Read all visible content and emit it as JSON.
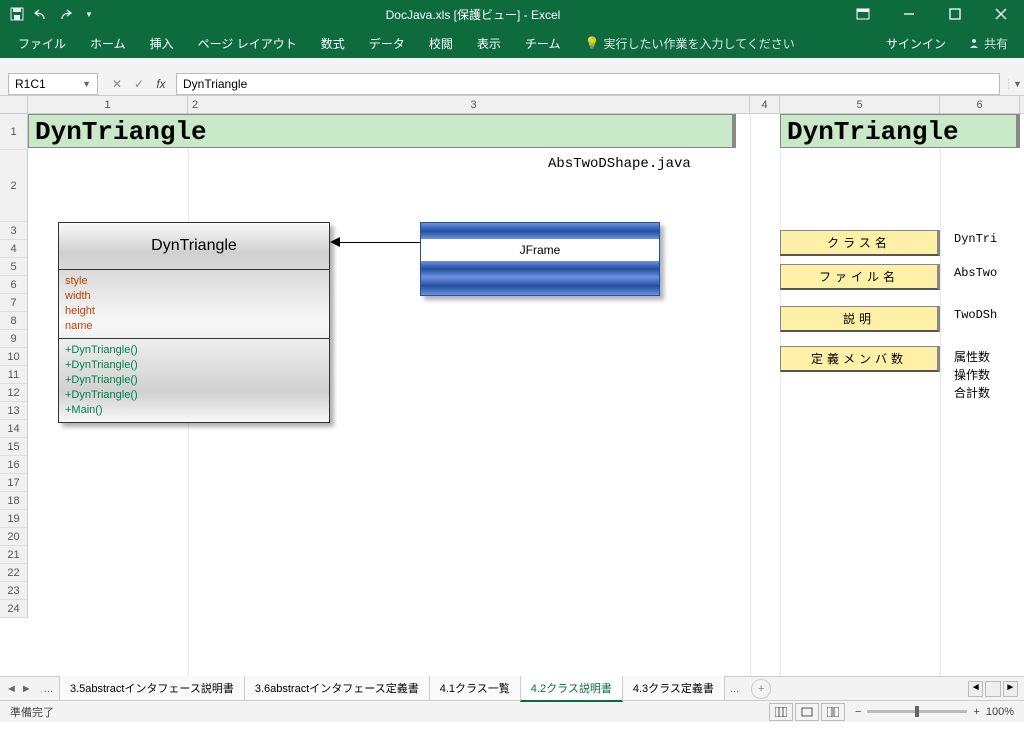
{
  "app": {
    "title": "DocJava.xls  [保護ビュー] - Excel"
  },
  "ribbon": {
    "file": "ファイル",
    "home": "ホーム",
    "insert": "挿入",
    "pagelayout": "ページ レイアウト",
    "formulas": "数式",
    "data": "データ",
    "review": "校閲",
    "view": "表示",
    "team": "チーム",
    "tellme": "実行したい作業を入力してください",
    "signin": "サインイン",
    "share": "共有"
  },
  "fx": {
    "namebox": "R1C1",
    "formula": "DynTriangle"
  },
  "cols": {
    "c1": "1",
    "c2": "2",
    "c3": "3",
    "c4": "4",
    "c5": "5",
    "c6": "6"
  },
  "content": {
    "header1": "DynTriangle",
    "header2": "DynTriangle",
    "subfile": "AbsTwoDShape.java",
    "uml": {
      "name": "DynTriangle",
      "attrs": [
        "style",
        "width",
        "height",
        "name"
      ],
      "ops": [
        "+DynTriangle()",
        "+DynTriangle()",
        "+DynTriangle()",
        "+DynTriangle()",
        "+Main()"
      ]
    },
    "jframe": "JFrame",
    "labels": {
      "classname": "クラス名",
      "filename": "ファイル名",
      "desc": "説明",
      "members": "定義メンバ数"
    },
    "side": {
      "v1": "DynTri",
      "v2": "AbsTwo",
      "v3": "TwoDSh",
      "v4": "属性数",
      "v5": "操作数",
      "v6": "合計数"
    }
  },
  "tabs": {
    "t1": "3.5abstractインタフェース説明書",
    "t2": "3.6abstractインタフェース定義書",
    "t3": "4.1クラス一覧",
    "t4": "4.2クラス説明書",
    "t5": "4.3クラス定義書"
  },
  "status": {
    "ready": "準備完了",
    "zoom": "100%"
  }
}
